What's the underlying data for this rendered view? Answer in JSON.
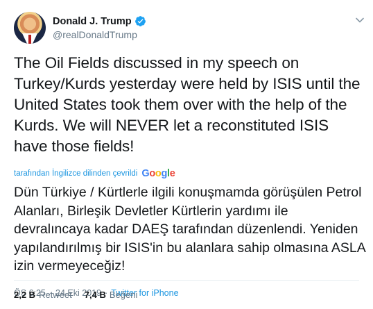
{
  "author": {
    "display_name": "Donald J. Trump",
    "handle": "@realDonaldTrump",
    "verified_icon": "verified-badge-icon"
  },
  "tweet": {
    "text_en": "The Oil Fields discussed in my speech on Turkey/Kurds yesterday were held by ISIS until the United States took them over with the help of the Kurds. We will NEVER let a reconstituted ISIS have those fields!",
    "translated_by": "tarafından İngilizce dilinden çevrildi",
    "translator": {
      "g": "G",
      "o1": "o",
      "o2": "o",
      "g2": "g",
      "l": "l",
      "e": "e"
    },
    "text_tr": "Dün Türkiye / Kürtlerle ilgili konuşmamda görüşülen Petrol Alanları, Birleşik Devletler Kürtlerin yardımı ile devralıncaya kadar DAEŞ tarafından düzenlendi. Yeniden yapılandırılmış bir ISIS'in bu alanlara sahip olmasına ASLA izin vermeyeceğiz!"
  },
  "meta": {
    "time": "ÖS 6:25",
    "separator": "·",
    "date": "24 Eki 2019",
    "source": "Twitter for iPhone"
  },
  "stats": {
    "retweets_count": "2,2 B",
    "retweets_label": "Retweet",
    "likes_count": "7,4 B",
    "likes_label": "Beğeni"
  },
  "colors": {
    "link": "#1b95e0",
    "verified": "#1da1f2",
    "secondary_text": "#657786"
  }
}
